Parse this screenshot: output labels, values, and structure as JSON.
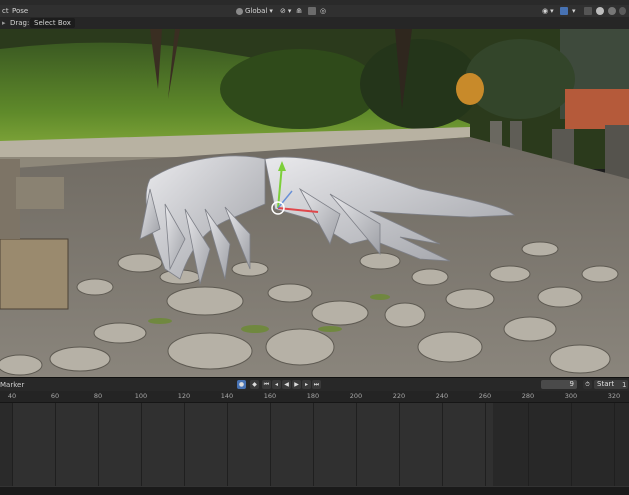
{
  "header": {
    "edit_mode_label": "ct",
    "pose_menu": "Pose",
    "orientation": "Global"
  },
  "tool_header": {
    "mode_label": "Drag:",
    "drag_value": "Select Box"
  },
  "timeline": {
    "marker_menu": "Marker",
    "current_frame": "9",
    "start_label": "Start",
    "start_value": "1",
    "ruler_ticks": [
      "40",
      "60",
      "80",
      "100",
      "120",
      "140",
      "160",
      "180",
      "200",
      "220",
      "240",
      "260",
      "280",
      "300",
      "320"
    ]
  },
  "colors": {
    "accent": "#4772b3",
    "gizmo_y": "#7dcf3a",
    "gizmo_x": "#e0474b",
    "gizmo_z": "#4d7fd6"
  }
}
